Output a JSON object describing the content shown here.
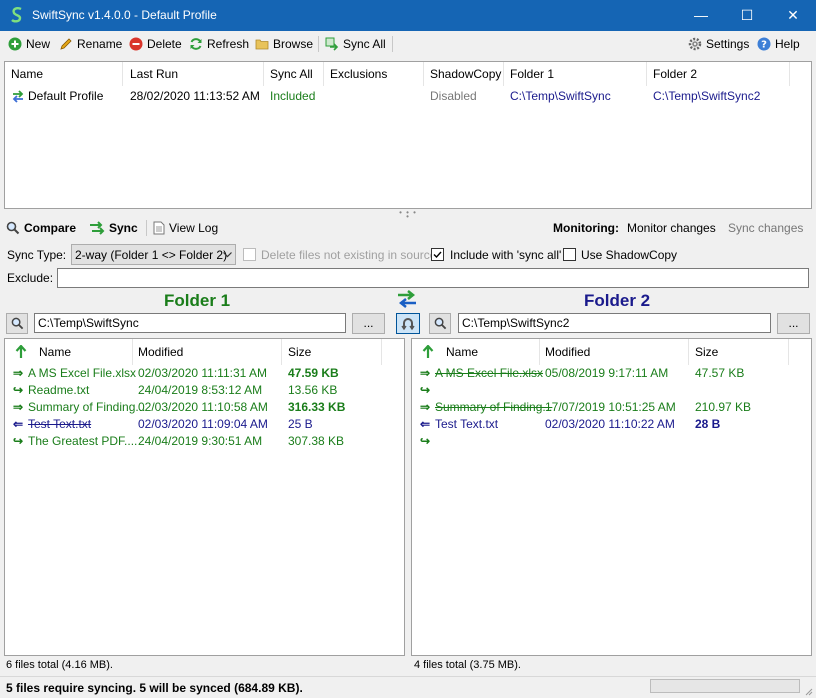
{
  "window": {
    "title": "SwiftSync v1.4.0.0 - Default Profile",
    "controls": {
      "minimize": "—",
      "maximize": "☐",
      "close": "✕"
    },
    "accent": "#1565b4"
  },
  "toolbar": {
    "new": "New",
    "rename": "Rename",
    "delete": "Delete",
    "refresh": "Refresh",
    "browse": "Browse",
    "sync_all": "Sync All",
    "settings": "Settings",
    "help": "Help"
  },
  "profiles": {
    "columns": [
      "Name",
      "Last Run",
      "Sync All",
      "Exclusions",
      "ShadowCopy",
      "Folder 1",
      "Folder 2"
    ],
    "rows": [
      {
        "name": "Default Profile",
        "last_run": "28/02/2020 11:13:52 AM",
        "sync_all": "Included",
        "exclusions": "",
        "shadowcopy": "Disabled",
        "folder1": "C:\\Temp\\SwiftSync",
        "folder2": "C:\\Temp\\SwiftSync2"
      }
    ]
  },
  "panel": {
    "tabs": {
      "compare": "Compare",
      "sync": "Sync",
      "view_log": "View Log"
    },
    "monitoring_label": "Monitoring:",
    "monitor_changes": "Monitor changes",
    "sync_changes": "Sync changes",
    "sync_type_label": "Sync Type:",
    "sync_type_value": "2-way (Folder 1 <> Folder 2)",
    "delete_files_label": "Delete files not existing in source",
    "include_sync_all_label": "Include with 'sync all'",
    "use_shadowcopy_label": "Use ShadowCopy",
    "exclude_label": "Exclude:",
    "exclude_value": "",
    "browse_button": "...",
    "swap_glyph": "⇄"
  },
  "folder1": {
    "heading": "Folder 1",
    "path": "C:\\Temp\\SwiftSync",
    "columns": [
      "Name",
      "Modified",
      "Size"
    ],
    "files": [
      {
        "name": "A MS Excel File.xlsx",
        "modified": "02/03/2020 11:11:31 AM",
        "size": "47.59 KB",
        "style": "green-bold",
        "arrow": "⇒"
      },
      {
        "name": "Readme.txt",
        "modified": "24/04/2019 8:53:12 AM",
        "size": "13.56 KB",
        "style": "green",
        "arrow": "↪"
      },
      {
        "name": "Summary of Finding...",
        "modified": "02/03/2020 11:10:58 AM",
        "size": "316.33 KB",
        "style": "green-bold",
        "arrow": "⇒"
      },
      {
        "name": "Test Text.txt",
        "modified": "02/03/2020 11:09:04 AM",
        "size": "25 B",
        "style": "navy-strike",
        "arrow": "⇐"
      },
      {
        "name": "The Greatest PDF....",
        "modified": "24/04/2019 9:30:51 AM",
        "size": "307.38 KB",
        "style": "green",
        "arrow": "↪"
      }
    ],
    "total": "6 files total (4.16 MB)."
  },
  "folder2": {
    "heading": "Folder 2",
    "path": "C:\\Temp\\SwiftSync2",
    "columns": [
      "Name",
      "Modified",
      "Size"
    ],
    "files": [
      {
        "name": "A MS Excel File.xlsx",
        "modified": "05/08/2019 9:17:11 AM",
        "size": "47.57 KB",
        "style": "green-strike",
        "arrow": "⇒"
      },
      {
        "name": "",
        "modified": "",
        "size": "",
        "style": "green",
        "arrow": "↪"
      },
      {
        "name": "Summary of Finding...",
        "modified": "17/07/2019 10:51:25 AM",
        "size": "210.97 KB",
        "style": "green-strike",
        "arrow": "⇒"
      },
      {
        "name": "Test Text.txt",
        "modified": "02/03/2020 11:10:22 AM",
        "size": "28 B",
        "style": "navy-bold",
        "arrow": "⇐"
      },
      {
        "name": "",
        "modified": "",
        "size": "",
        "style": "green",
        "arrow": "↪"
      }
    ],
    "total": "4 files total (3.75 MB)."
  },
  "status": {
    "message": "5 files require syncing. 5 will be synced (684.89 KB)."
  }
}
